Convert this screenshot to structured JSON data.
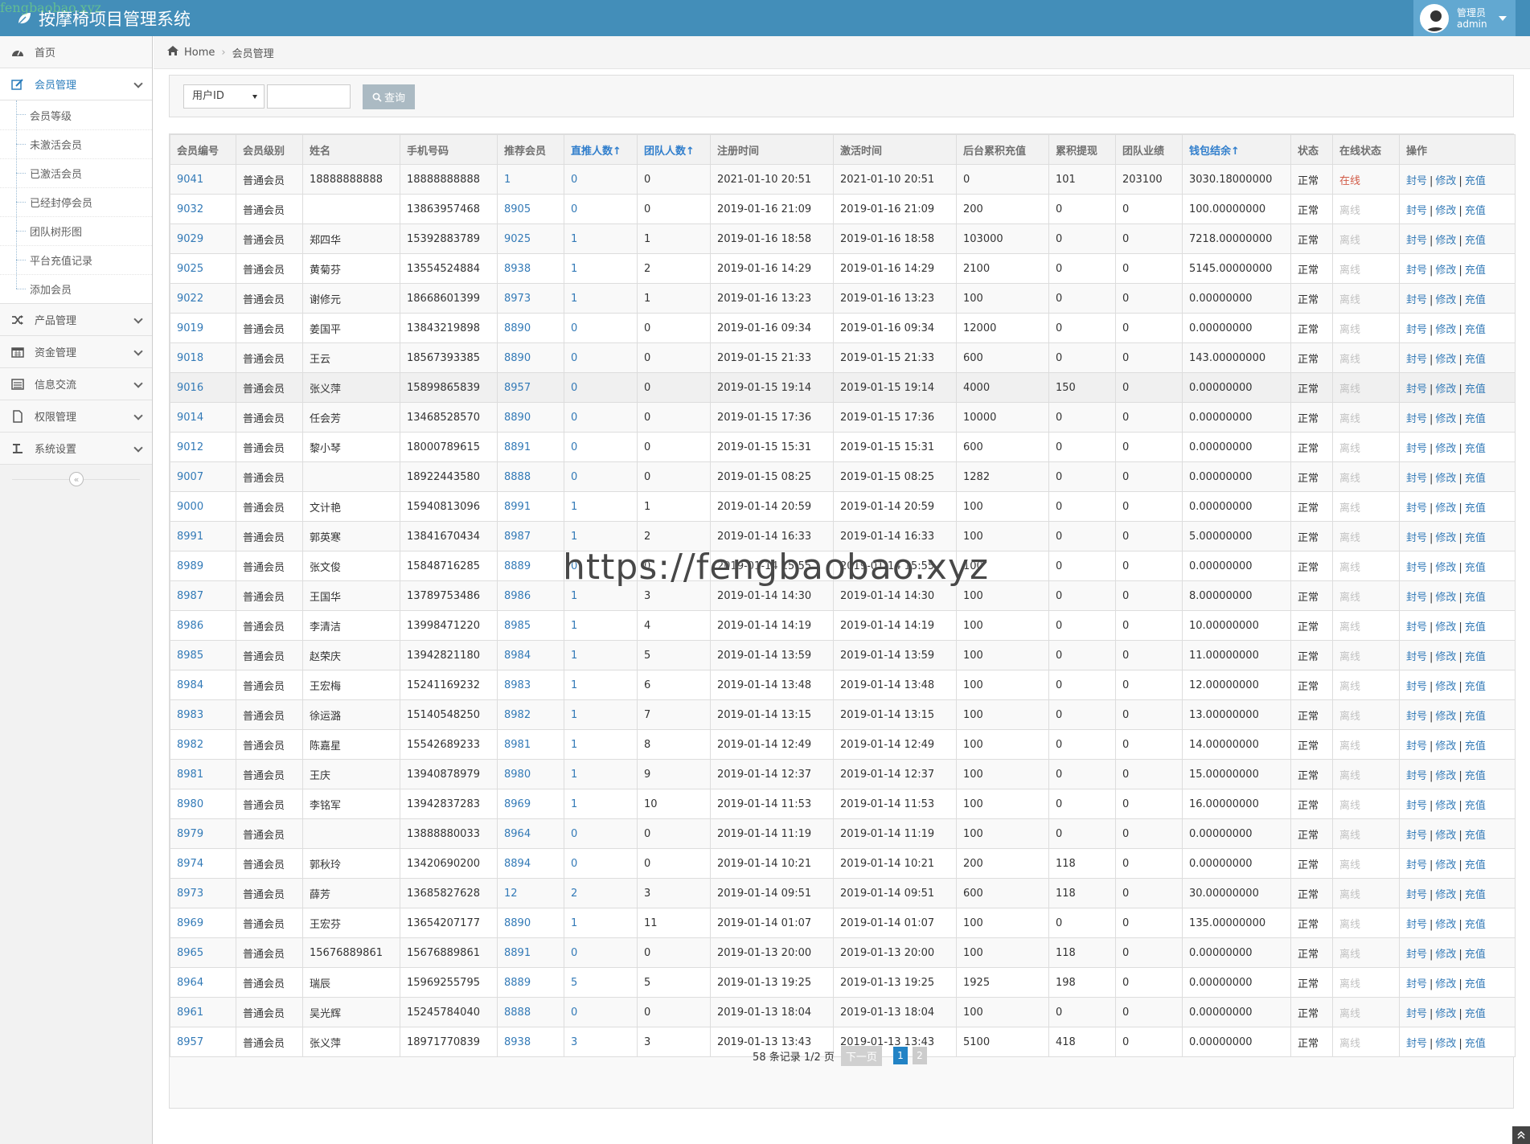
{
  "app": {
    "title": "按摩椅项目管理系统",
    "watermark_top": "fengbaobao.xyz",
    "watermark_center": "https://fengbaobao.xyz"
  },
  "user": {
    "role": "管理员",
    "name": "admin"
  },
  "sidebar": {
    "items": [
      {
        "label": "首页",
        "icon": "dashboard-icon"
      },
      {
        "label": "会员管理",
        "icon": "edit-icon",
        "open": true,
        "children": [
          "会员等级",
          "未激活会员",
          "已激活会员",
          "已经封停会员",
          "团队树形图",
          "平台充值记录",
          "添加会员"
        ]
      },
      {
        "label": "产品管理",
        "icon": "random-icon"
      },
      {
        "label": "资金管理",
        "icon": "calendar-icon"
      },
      {
        "label": "信息交流",
        "icon": "list-alt-icon"
      },
      {
        "label": "权限管理",
        "icon": "file-icon"
      },
      {
        "label": "系统设置",
        "icon": "text-icon"
      }
    ]
  },
  "breadcrumb": {
    "home": "Home",
    "current": "会员管理"
  },
  "filter": {
    "select_value": "用户ID",
    "input_value": "",
    "search_label": "查询"
  },
  "table": {
    "headers": [
      "会员编号",
      "会员级别",
      "姓名",
      "手机号码",
      "推荐会员",
      "直推人数↑",
      "团队人数↑",
      "注册时间",
      "激活时间",
      "后台累积充值",
      "累积提现",
      "团队业绩",
      "钱包结余↑",
      "状态",
      "在线状态",
      "操作"
    ],
    "actions": [
      "封号",
      "修改",
      "充值"
    ],
    "rows": [
      [
        "9041",
        "普通会员",
        "18888888888",
        "18888888888",
        "1",
        "0",
        "0",
        "2021-01-10 20:51",
        "2021-01-10 20:51",
        "0",
        "101",
        "203100",
        "3030.18000000",
        "正常",
        "在线"
      ],
      [
        "9032",
        "普通会员",
        "",
        "13863957468",
        "8905",
        "0",
        "0",
        "2019-01-16 21:09",
        "2019-01-16 21:09",
        "200",
        "0",
        "0",
        "100.00000000",
        "正常",
        "离线"
      ],
      [
        "9029",
        "普通会员",
        "郑四华",
        "15392883789",
        "9025",
        "1",
        "1",
        "2019-01-16 18:58",
        "2019-01-16 18:58",
        "103000",
        "0",
        "0",
        "7218.00000000",
        "正常",
        "离线"
      ],
      [
        "9025",
        "普通会员",
        "黄菊芬",
        "13554524884",
        "8938",
        "1",
        "2",
        "2019-01-16 14:29",
        "2019-01-16 14:29",
        "2100",
        "0",
        "0",
        "5145.00000000",
        "正常",
        "离线"
      ],
      [
        "9022",
        "普通会员",
        "谢修元",
        "18668601399",
        "8973",
        "1",
        "1",
        "2019-01-16 13:23",
        "2019-01-16 13:23",
        "100",
        "0",
        "0",
        "0.00000000",
        "正常",
        "离线"
      ],
      [
        "9019",
        "普通会员",
        "姜国平",
        "13843219898",
        "8890",
        "0",
        "0",
        "2019-01-16 09:34",
        "2019-01-16 09:34",
        "12000",
        "0",
        "0",
        "0.00000000",
        "正常",
        "离线"
      ],
      [
        "9018",
        "普通会员",
        "王云",
        "18567393385",
        "8890",
        "0",
        "0",
        "2019-01-15 21:33",
        "2019-01-15 21:33",
        "600",
        "0",
        "0",
        "143.00000000",
        "正常",
        "离线"
      ],
      [
        "9016",
        "普通会员",
        "张义萍",
        "15899865839",
        "8957",
        "0",
        "0",
        "2019-01-15 19:14",
        "2019-01-15 19:14",
        "4000",
        "150",
        "0",
        "0.00000000",
        "正常",
        "离线"
      ],
      [
        "9014",
        "普通会员",
        "任会芳",
        "13468528570",
        "8890",
        "0",
        "0",
        "2019-01-15 17:36",
        "2019-01-15 17:36",
        "10000",
        "0",
        "0",
        "0.00000000",
        "正常",
        "离线"
      ],
      [
        "9012",
        "普通会员",
        "黎小琴",
        "18000789615",
        "8891",
        "0",
        "0",
        "2019-01-15 15:31",
        "2019-01-15 15:31",
        "600",
        "0",
        "0",
        "0.00000000",
        "正常",
        "离线"
      ],
      [
        "9007",
        "普通会员",
        "",
        "18922443580",
        "8888",
        "0",
        "0",
        "2019-01-15 08:25",
        "2019-01-15 08:25",
        "1282",
        "0",
        "0",
        "0.00000000",
        "正常",
        "离线"
      ],
      [
        "9000",
        "普通会员",
        "文计艳",
        "15940813096",
        "8991",
        "1",
        "1",
        "2019-01-14 20:59",
        "2019-01-14 20:59",
        "100",
        "0",
        "0",
        "0.00000000",
        "正常",
        "离线"
      ],
      [
        "8991",
        "普通会员",
        "郭英寒",
        "13841670434",
        "8987",
        "1",
        "2",
        "2019-01-14 16:33",
        "2019-01-14 16:33",
        "100",
        "0",
        "0",
        "5.00000000",
        "正常",
        "离线"
      ],
      [
        "8989",
        "普通会员",
        "张文俊",
        "15848716285",
        "8889",
        "0",
        "0",
        "2019-01-14 15:55",
        "2019-01-14 15:55",
        "100",
        "0",
        "0",
        "0.00000000",
        "正常",
        "离线"
      ],
      [
        "8987",
        "普通会员",
        "王国华",
        "13789753486",
        "8986",
        "1",
        "3",
        "2019-01-14 14:30",
        "2019-01-14 14:30",
        "100",
        "0",
        "0",
        "8.00000000",
        "正常",
        "离线"
      ],
      [
        "8986",
        "普通会员",
        "李清洁",
        "13998471220",
        "8985",
        "1",
        "4",
        "2019-01-14 14:19",
        "2019-01-14 14:19",
        "100",
        "0",
        "0",
        "10.00000000",
        "正常",
        "离线"
      ],
      [
        "8985",
        "普通会员",
        "赵荣庆",
        "13942821180",
        "8984",
        "1",
        "5",
        "2019-01-14 13:59",
        "2019-01-14 13:59",
        "100",
        "0",
        "0",
        "11.00000000",
        "正常",
        "离线"
      ],
      [
        "8984",
        "普通会员",
        "王宏梅",
        "15241169232",
        "8983",
        "1",
        "6",
        "2019-01-14 13:48",
        "2019-01-14 13:48",
        "100",
        "0",
        "0",
        "12.00000000",
        "正常",
        "离线"
      ],
      [
        "8983",
        "普通会员",
        "徐运潞",
        "15140548250",
        "8982",
        "1",
        "7",
        "2019-01-14 13:15",
        "2019-01-14 13:15",
        "100",
        "0",
        "0",
        "13.00000000",
        "正常",
        "离线"
      ],
      [
        "8982",
        "普通会员",
        "陈嘉星",
        "15542689233",
        "8981",
        "1",
        "8",
        "2019-01-14 12:49",
        "2019-01-14 12:49",
        "100",
        "0",
        "0",
        "14.00000000",
        "正常",
        "离线"
      ],
      [
        "8981",
        "普通会员",
        "王庆",
        "13940878979",
        "8980",
        "1",
        "9",
        "2019-01-14 12:37",
        "2019-01-14 12:37",
        "100",
        "0",
        "0",
        "15.00000000",
        "正常",
        "离线"
      ],
      [
        "8980",
        "普通会员",
        "李铭军",
        "13942837283",
        "8969",
        "1",
        "10",
        "2019-01-14 11:53",
        "2019-01-14 11:53",
        "100",
        "0",
        "0",
        "16.00000000",
        "正常",
        "离线"
      ],
      [
        "8979",
        "普通会员",
        "",
        "13888880033",
        "8964",
        "0",
        "0",
        "2019-01-14 11:19",
        "2019-01-14 11:19",
        "100",
        "0",
        "0",
        "0.00000000",
        "正常",
        "离线"
      ],
      [
        "8974",
        "普通会员",
        "郭秋玲",
        "13420690200",
        "8894",
        "0",
        "0",
        "2019-01-14 10:21",
        "2019-01-14 10:21",
        "200",
        "118",
        "0",
        "0.00000000",
        "正常",
        "离线"
      ],
      [
        "8973",
        "普通会员",
        "薛芳",
        "13685827628",
        "12",
        "2",
        "3",
        "2019-01-14 09:51",
        "2019-01-14 09:51",
        "600",
        "118",
        "0",
        "30.00000000",
        "正常",
        "离线"
      ],
      [
        "8969",
        "普通会员",
        "王宏芬",
        "13654207177",
        "8890",
        "1",
        "11",
        "2019-01-14 01:07",
        "2019-01-14 01:07",
        "100",
        "0",
        "0",
        "135.00000000",
        "正常",
        "离线"
      ],
      [
        "8965",
        "普通会员",
        "15676889861",
        "15676889861",
        "8891",
        "0",
        "0",
        "2019-01-13 20:00",
        "2019-01-13 20:00",
        "100",
        "118",
        "0",
        "0.00000000",
        "正常",
        "离线"
      ],
      [
        "8964",
        "普通会员",
        "瑞辰",
        "15969255795",
        "8889",
        "5",
        "5",
        "2019-01-13 19:25",
        "2019-01-13 19:25",
        "1925",
        "198",
        "0",
        "0.00000000",
        "正常",
        "离线"
      ],
      [
        "8961",
        "普通会员",
        "吴光辉",
        "15245784040",
        "8888",
        "0",
        "0",
        "2019-01-13 18:04",
        "2019-01-13 18:04",
        "100",
        "0",
        "0",
        "0.00000000",
        "正常",
        "离线"
      ],
      [
        "8957",
        "普通会员",
        "张义萍",
        "18971770839",
        "8938",
        "3",
        "3",
        "2019-01-13 13:43",
        "2019-01-13 13:43",
        "5100",
        "418",
        "0",
        "0.00000000",
        "正常",
        "离线"
      ]
    ]
  },
  "pager": {
    "info": "58 条记录 1/2 页",
    "next_label": "下一页",
    "pages": [
      "1",
      "2"
    ],
    "current_page": "1"
  },
  "colors": {
    "topbar": "#438eb9",
    "link": "#337ab7",
    "online": "#d15b47",
    "offline": "#c2c2c2"
  }
}
